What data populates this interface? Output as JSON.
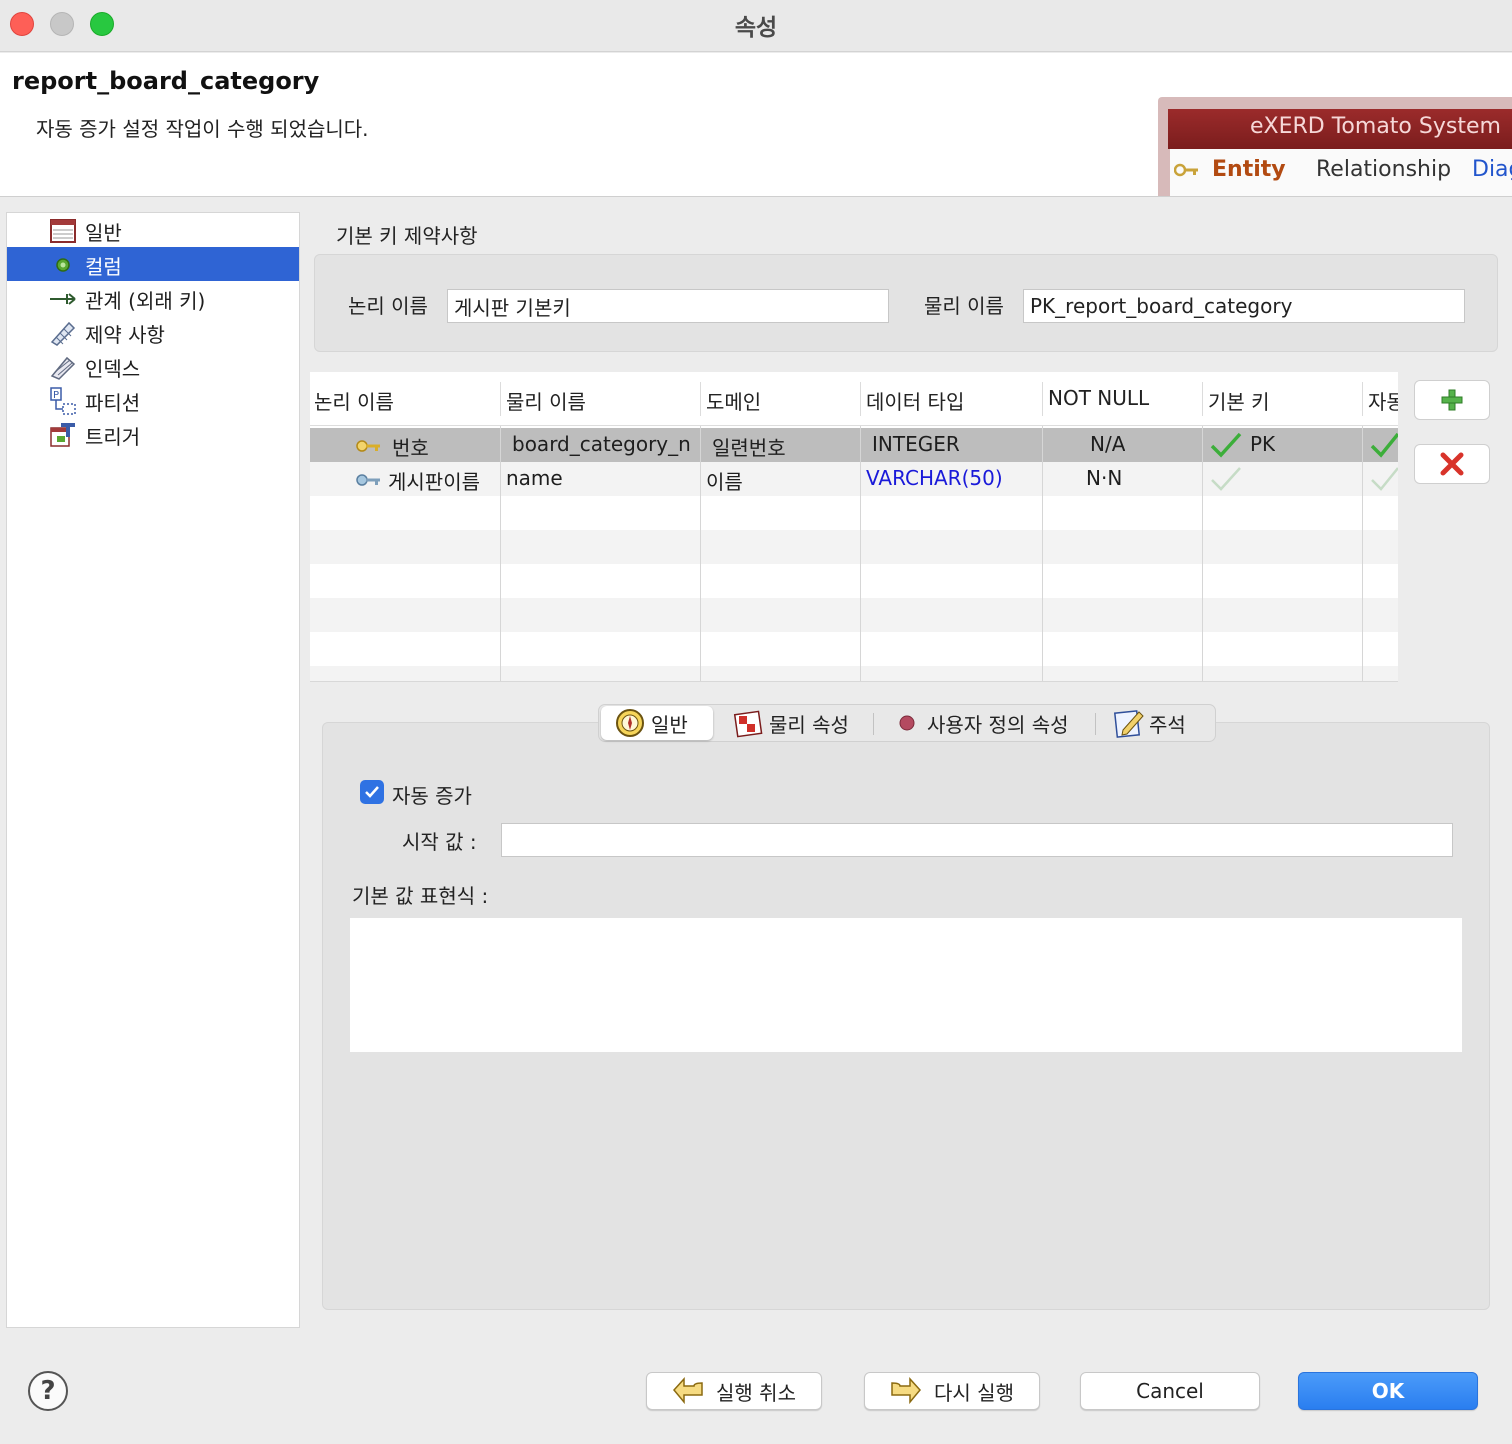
{
  "window": {
    "title": "속성"
  },
  "header": {
    "entity_name": "report_board_category",
    "message": "자동 증가 설정 작업이 수행 되었습니다.",
    "banner": {
      "product": "eXERD  Tomato System",
      "tabs": [
        "Entity",
        "Relationship",
        "Diag"
      ]
    }
  },
  "sidebar": {
    "items": [
      {
        "label": "일반",
        "icon": "table-icon"
      },
      {
        "label": "컬럼",
        "icon": "column-icon",
        "active": true
      },
      {
        "label": "관계 (외래 키)",
        "icon": "relationship-icon"
      },
      {
        "label": "제약 사항",
        "icon": "constraint-icon"
      },
      {
        "label": "인덱스",
        "icon": "index-icon"
      },
      {
        "label": "파티션",
        "icon": "partition-icon"
      },
      {
        "label": "트리거",
        "icon": "trigger-icon"
      }
    ]
  },
  "pk": {
    "section_title": "기본 키 제약사항",
    "logical_label": "논리 이름",
    "logical_value": "게시판 기본키",
    "physical_label": "물리 이름",
    "physical_value": "PK_report_board_category"
  },
  "grid": {
    "columns": [
      "논리 이름",
      "물리 이름",
      "도메인",
      "데이터 타입",
      "NOT NULL",
      "기본 키",
      "자동"
    ],
    "rows": [
      {
        "logical": "번호",
        "physical": "board_category_n",
        "domain": "일련번호",
        "type": "INTEGER",
        "not_null": "N/A",
        "pk": "PK",
        "pk_checked": true,
        "auto_checked": true,
        "key_icon": "pk-key-icon"
      },
      {
        "logical": "게시판이름",
        "physical": "name",
        "domain": "이름",
        "type": "VARCHAR(50)",
        "not_null": "N·N",
        "pk": "",
        "pk_checked": false,
        "auto_checked": false,
        "key_icon": "column-key-icon"
      }
    ]
  },
  "tabs": {
    "items": [
      "일반",
      "물리 속성",
      "사용자 정의 속성",
      "주석"
    ],
    "active": 0
  },
  "general": {
    "auto_increment_label": "자동 증가",
    "auto_increment_checked": true,
    "start_value_label": "시작 값 :",
    "start_value": "",
    "default_expr_label": "기본 값 표현식 :",
    "default_expr": ""
  },
  "footer": {
    "undo_label": "실행 취소",
    "redo_label": "다시 실행",
    "cancel_label": "Cancel",
    "ok_label": "OK"
  },
  "colors": {
    "selection": "#2f64d4",
    "accent": "#2a7ef0",
    "type_highlight": "#1a1ad9"
  }
}
